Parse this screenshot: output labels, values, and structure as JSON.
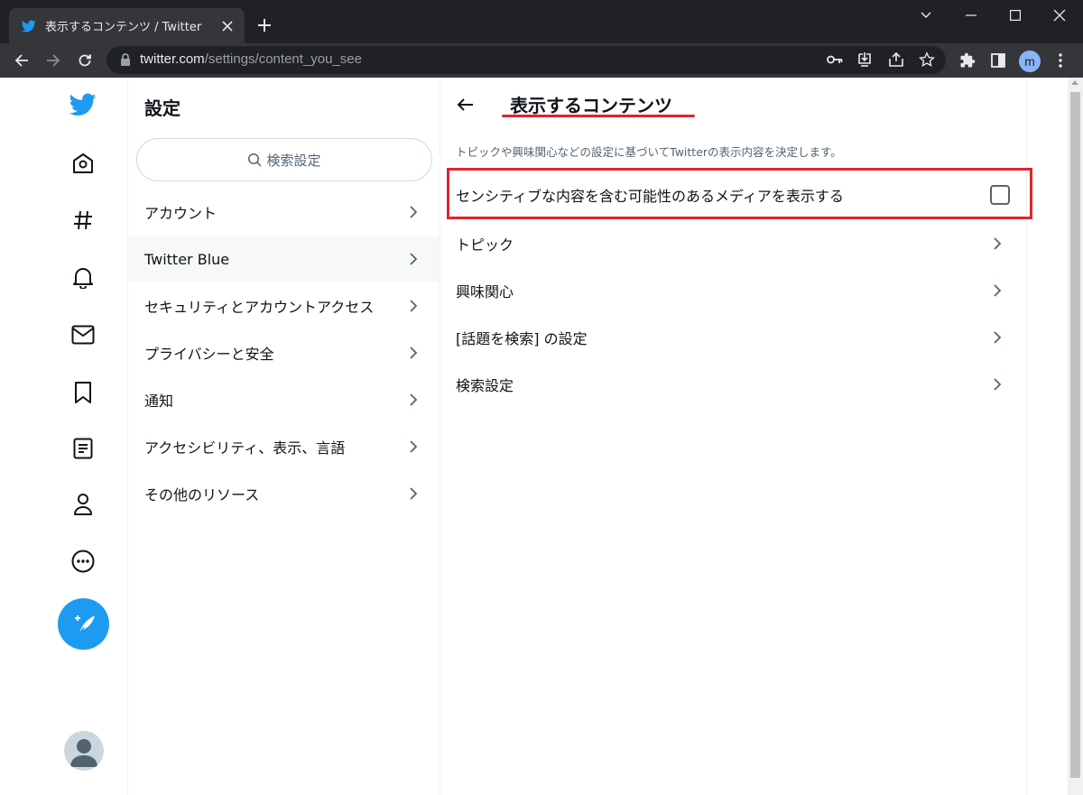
{
  "browser": {
    "tab_title": "表示するコンテンツ / Twitter",
    "url_host": "twitter.com",
    "url_path": "/settings/content_you_see",
    "profile_initial": "m"
  },
  "colors": {
    "twitter_blue": "#1d9bf0",
    "highlight_red": "#e0242f"
  },
  "rail": {
    "icons": [
      "twitter-logo-icon",
      "home-icon",
      "explore-hashtag-icon",
      "notifications-bell-icon",
      "messages-envelope-icon",
      "bookmarks-icon",
      "lists-icon",
      "profile-icon",
      "more-icon",
      "tweet-compose-icon",
      "avatar"
    ]
  },
  "settings": {
    "title": "設定",
    "search_placeholder": "検索設定",
    "items": [
      {
        "label": "アカウント"
      },
      {
        "label": "Twitter Blue",
        "active": true
      },
      {
        "label": "セキュリティとアカウントアクセス"
      },
      {
        "label": "プライバシーと安全"
      },
      {
        "label": "通知"
      },
      {
        "label": "アクセシビリティ、表示、言語"
      },
      {
        "label": "その他のリソース"
      }
    ]
  },
  "content": {
    "title": "表示するコンテンツ",
    "description": "トピックや興味関心などの設定に基づいてTwitterの表示内容を決定します。",
    "sensitive_media": {
      "label": "センシティブな内容を含む可能性のあるメディアを表示する",
      "checked": false
    },
    "rows": [
      {
        "label": "トピック"
      },
      {
        "label": "興味関心"
      },
      {
        "label": "[話題を検索] の設定"
      },
      {
        "label": "検索設定"
      }
    ]
  }
}
